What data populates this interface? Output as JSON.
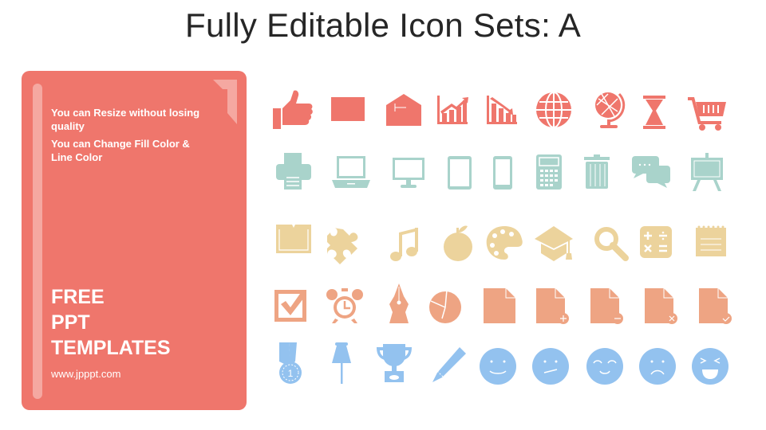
{
  "title": "Fully Editable Icon Sets: A",
  "card": {
    "note1": "You can Resize without losing quality",
    "note2": "You can Change Fill Color & Line Color",
    "headline_lines": [
      "FREE",
      "PPT",
      "TEMPLATES"
    ],
    "url": "www.jpppt.com"
  },
  "colors": {
    "card": "#ef766c",
    "row1": "#ef766c",
    "row2": "#a9d3cb",
    "row3": "#ecd39c",
    "row4": "#eea483",
    "row5": "#93c2ef"
  },
  "icon_rows": [
    [
      "thumbs-up",
      "envelope-closed",
      "envelope-open",
      "chart-up",
      "chart-down",
      "globe",
      "desk-globe",
      "hourglass",
      "shopping-cart"
    ],
    [
      "printer",
      "laptop",
      "monitor",
      "tablet",
      "smartphone",
      "calculator",
      "trash-can",
      "chat-bubbles",
      "presentation-board"
    ],
    [
      "book",
      "puzzle-piece",
      "music-note",
      "apple",
      "paint-palette",
      "graduation-cap",
      "magnifier",
      "math-symbols",
      "notepad"
    ],
    [
      "checkbox",
      "alarm-clock",
      "fountain-pen",
      "pie-chart",
      "document",
      "document-add",
      "document-remove",
      "document-delete",
      "document-check"
    ],
    [
      "medal",
      "push-pin",
      "trophy",
      "pencil",
      "smiley-happy",
      "smiley-confused",
      "smiley-content",
      "smiley-sad",
      "smiley-laughing"
    ]
  ],
  "medal_label": "1"
}
